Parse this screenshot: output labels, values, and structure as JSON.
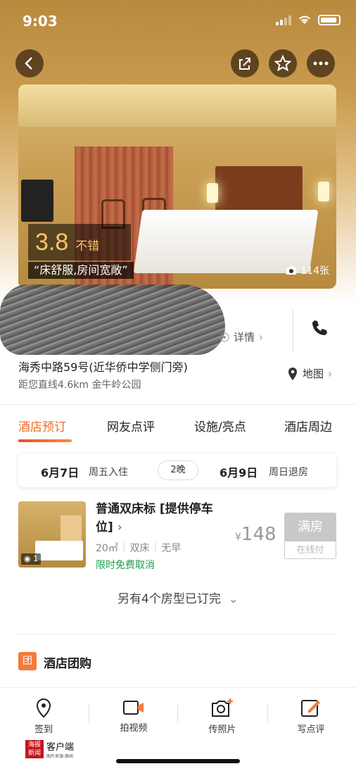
{
  "status_bar": {
    "time": "9:03"
  },
  "photo": {
    "score": "3.8",
    "score_word": "不错",
    "quote": "“床舒服,房间宽敞”",
    "photo_count": "114张"
  },
  "hotel": {
    "detail_label": "详情",
    "address": "海秀中路59号(近华侨中学侧门旁)",
    "distance": "距您直线4.6km 金牛岭公园",
    "map_label": "地图"
  },
  "tabs": [
    {
      "label": "酒店预订",
      "active": true
    },
    {
      "label": "网友点评",
      "active": false
    },
    {
      "label": "设施/亮点",
      "active": false
    },
    {
      "label": "酒店周边",
      "active": false
    }
  ],
  "booking": {
    "check_in_date": "6月7日",
    "check_in_label": "周五入住",
    "nights": "2晚",
    "check_out_date": "6月9日",
    "check_out_label": "周日退房"
  },
  "room": {
    "name": "普通双床标 [提供停车位]",
    "thumb_count": "1",
    "area": "20㎡",
    "bed": "双床",
    "breakfast": "无早",
    "cancel": "限时免费取消",
    "currency": "¥",
    "price": "148",
    "status": "满房",
    "pay_type": "在线付"
  },
  "sold_out_text": "另有4个房型已订完",
  "group_buy": {
    "icon": "团",
    "title": "酒店团购"
  },
  "bottom_bar": [
    {
      "label": "签到",
      "icon": "location-pin-icon"
    },
    {
      "label": "拍视频",
      "icon": "video-camera-icon"
    },
    {
      "label": "传照片",
      "icon": "camera-plus-icon"
    },
    {
      "label": "写点评",
      "icon": "edit-icon"
    }
  ],
  "watermark": {
    "brand_mark": "海报新闻",
    "brand": "客户端",
    "sub": "图片来源:挪闻"
  },
  "colors": {
    "accent": "#f36b22",
    "green": "#1d9c4d",
    "score": "#f6c56b"
  }
}
